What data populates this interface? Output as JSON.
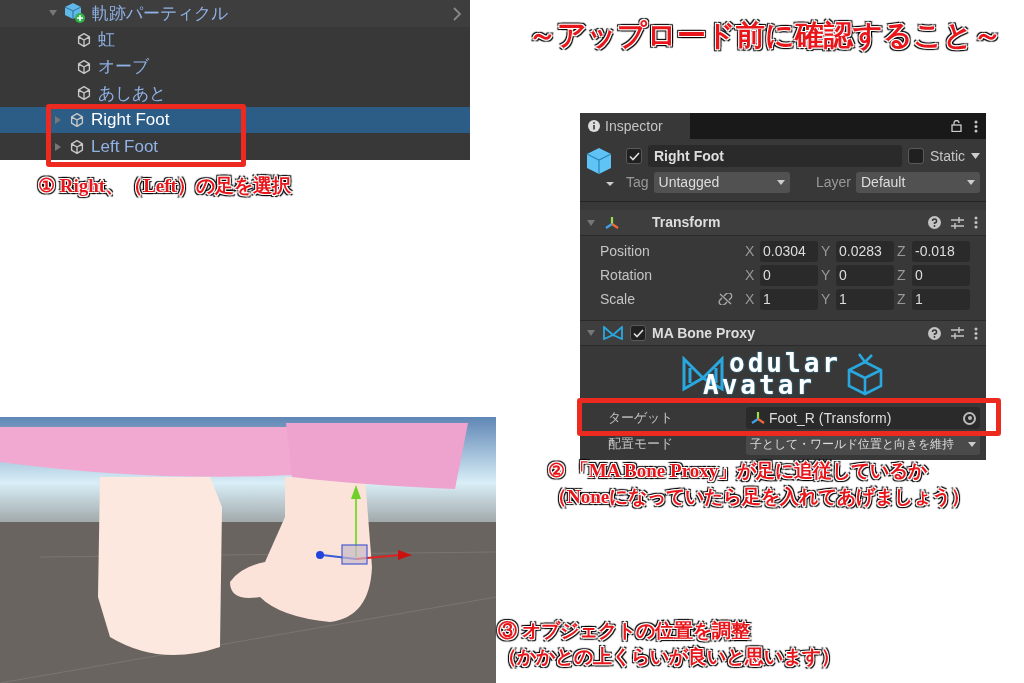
{
  "title": "～アップロード前に確認すること～",
  "hierarchy": {
    "items": [
      {
        "label": "軌跡パーティクル",
        "kind": "prefab",
        "expanded": true,
        "selected": false,
        "children": [
          {
            "label": "虹",
            "kind": "object",
            "selected": false
          },
          {
            "label": "オーブ",
            "kind": "object",
            "selected": false
          },
          {
            "label": "あしあと",
            "kind": "object",
            "selected": false
          },
          {
            "label": "Right Foot",
            "kind": "object",
            "selected": true,
            "expanded": false
          },
          {
            "label": "Left Foot",
            "kind": "object",
            "selected": false,
            "expanded": false
          }
        ]
      }
    ]
  },
  "step1": "① Right、（Left）の足を選択",
  "inspector": {
    "tab": "Inspector",
    "object": {
      "active": true,
      "name": "Right Foot",
      "static": false,
      "static_label": "Static",
      "tag_label": "Tag",
      "tag": "Untagged",
      "layer_label": "Layer",
      "layer": "Default"
    },
    "transform": {
      "title": "Transform",
      "expanded": true,
      "rows": [
        {
          "label": "Position",
          "fields": [
            {
              "axis": "X",
              "value": "0.0304"
            },
            {
              "axis": "Y",
              "value": "0.0283"
            },
            {
              "axis": "Z",
              "value": "-0.018"
            }
          ]
        },
        {
          "label": "Rotation",
          "fields": [
            {
              "axis": "X",
              "value": "0"
            },
            {
              "axis": "Y",
              "value": "0"
            },
            {
              "axis": "Z",
              "value": "0"
            }
          ]
        },
        {
          "label": "Scale",
          "proportional": false,
          "fields": [
            {
              "axis": "X",
              "value": "1"
            },
            {
              "axis": "Y",
              "value": "1"
            },
            {
              "axis": "Z",
              "value": "1"
            }
          ]
        }
      ]
    },
    "bone_proxy": {
      "title": "MA Bone Proxy",
      "enabled": true,
      "expanded": true,
      "logo": [
        "odular",
        "Avatar"
      ],
      "properties": [
        {
          "label": "ターゲット",
          "kind": "object",
          "value": "Foot_R (Transform)"
        },
        {
          "label": "配置モード",
          "kind": "dropdown",
          "value": "子として・ワールド位置と向きを維持"
        }
      ]
    }
  },
  "step2": [
    "② 「MA Bone Proxy」が足に追従しているか",
    "（Noneになっていたら足を入れてあげましょう）"
  ],
  "step3": [
    "③ オブジェクトの位置を調整",
    "（かかとの上くらいが良いと思います）"
  ]
}
